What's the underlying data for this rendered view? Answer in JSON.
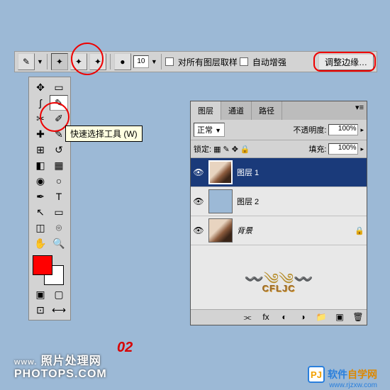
{
  "optionsBar": {
    "brushSize": "10",
    "sampleAll": "对所有图层取样",
    "autoEnhance": "自动增强",
    "refineEdge": "调整边缘…"
  },
  "tooltip": "快速选择工具 (W)",
  "layersPanel": {
    "tabs": {
      "layers": "图层",
      "channels": "通道",
      "paths": "路径"
    },
    "blendMode": "正常",
    "opacityLabel": "不透明度:",
    "opacityValue": "100%",
    "lockLabel": "锁定:",
    "fillLabel": "填充:",
    "fillValue": "100%",
    "items": [
      {
        "name": "图层 1",
        "selected": true,
        "type": "image"
      },
      {
        "name": "图层 2",
        "selected": false,
        "type": "solid"
      },
      {
        "name": "背景",
        "selected": false,
        "type": "image",
        "locked": true
      }
    ],
    "previewText": "CFLJC"
  },
  "annotation": "02",
  "watermark1": {
    "prefix": "www.",
    "main": "照片处理网",
    "domain": "PHOTOPS.COM"
  },
  "watermark2": {
    "logo": "PJ",
    "text1": "软件",
    "text2": "自学网",
    "url": "www.rjzxw.com"
  }
}
